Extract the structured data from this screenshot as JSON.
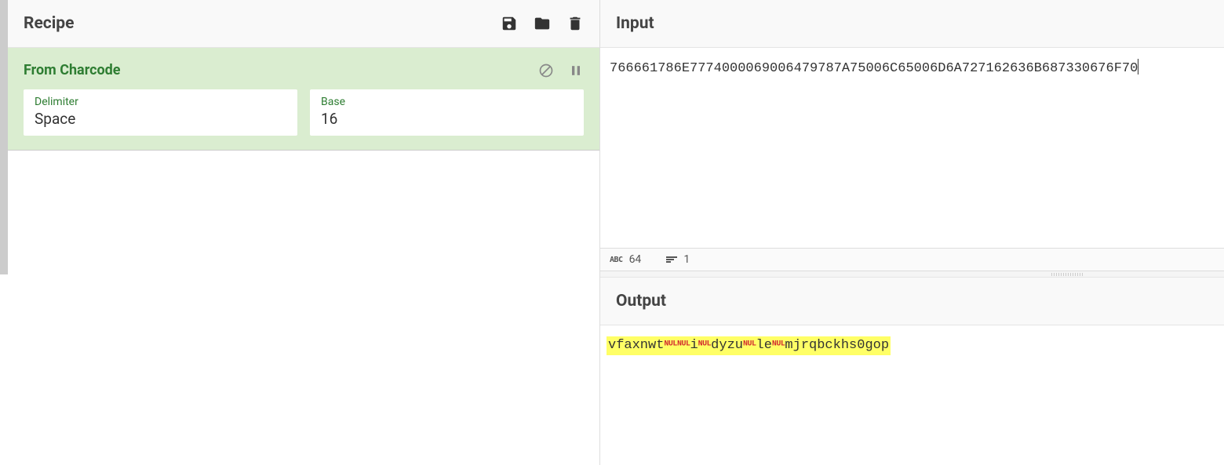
{
  "recipe": {
    "title": "Recipe",
    "operation": {
      "name": "From Charcode",
      "fields": {
        "delimiter": {
          "label": "Delimiter",
          "value": "Space"
        },
        "base": {
          "label": "Base",
          "value": "16"
        }
      }
    }
  },
  "input": {
    "title": "Input",
    "value": "766661786E7774000069006479787A75006C65006D6A727162636B687330676F70",
    "status": {
      "chars": "64",
      "lines": "1"
    }
  },
  "output": {
    "title": "Output",
    "segments": [
      {
        "t": "text",
        "v": "vfaxnwt"
      },
      {
        "t": "nul",
        "v": "NUL"
      },
      {
        "t": "nul",
        "v": "NUL"
      },
      {
        "t": "text",
        "v": "i"
      },
      {
        "t": "nul",
        "v": "NUL"
      },
      {
        "t": "text",
        "v": "dyzu"
      },
      {
        "t": "nul",
        "v": "NUL"
      },
      {
        "t": "text",
        "v": "le"
      },
      {
        "t": "nul",
        "v": "NUL"
      },
      {
        "t": "text",
        "v": "mjrqbckhs0gop"
      }
    ]
  }
}
